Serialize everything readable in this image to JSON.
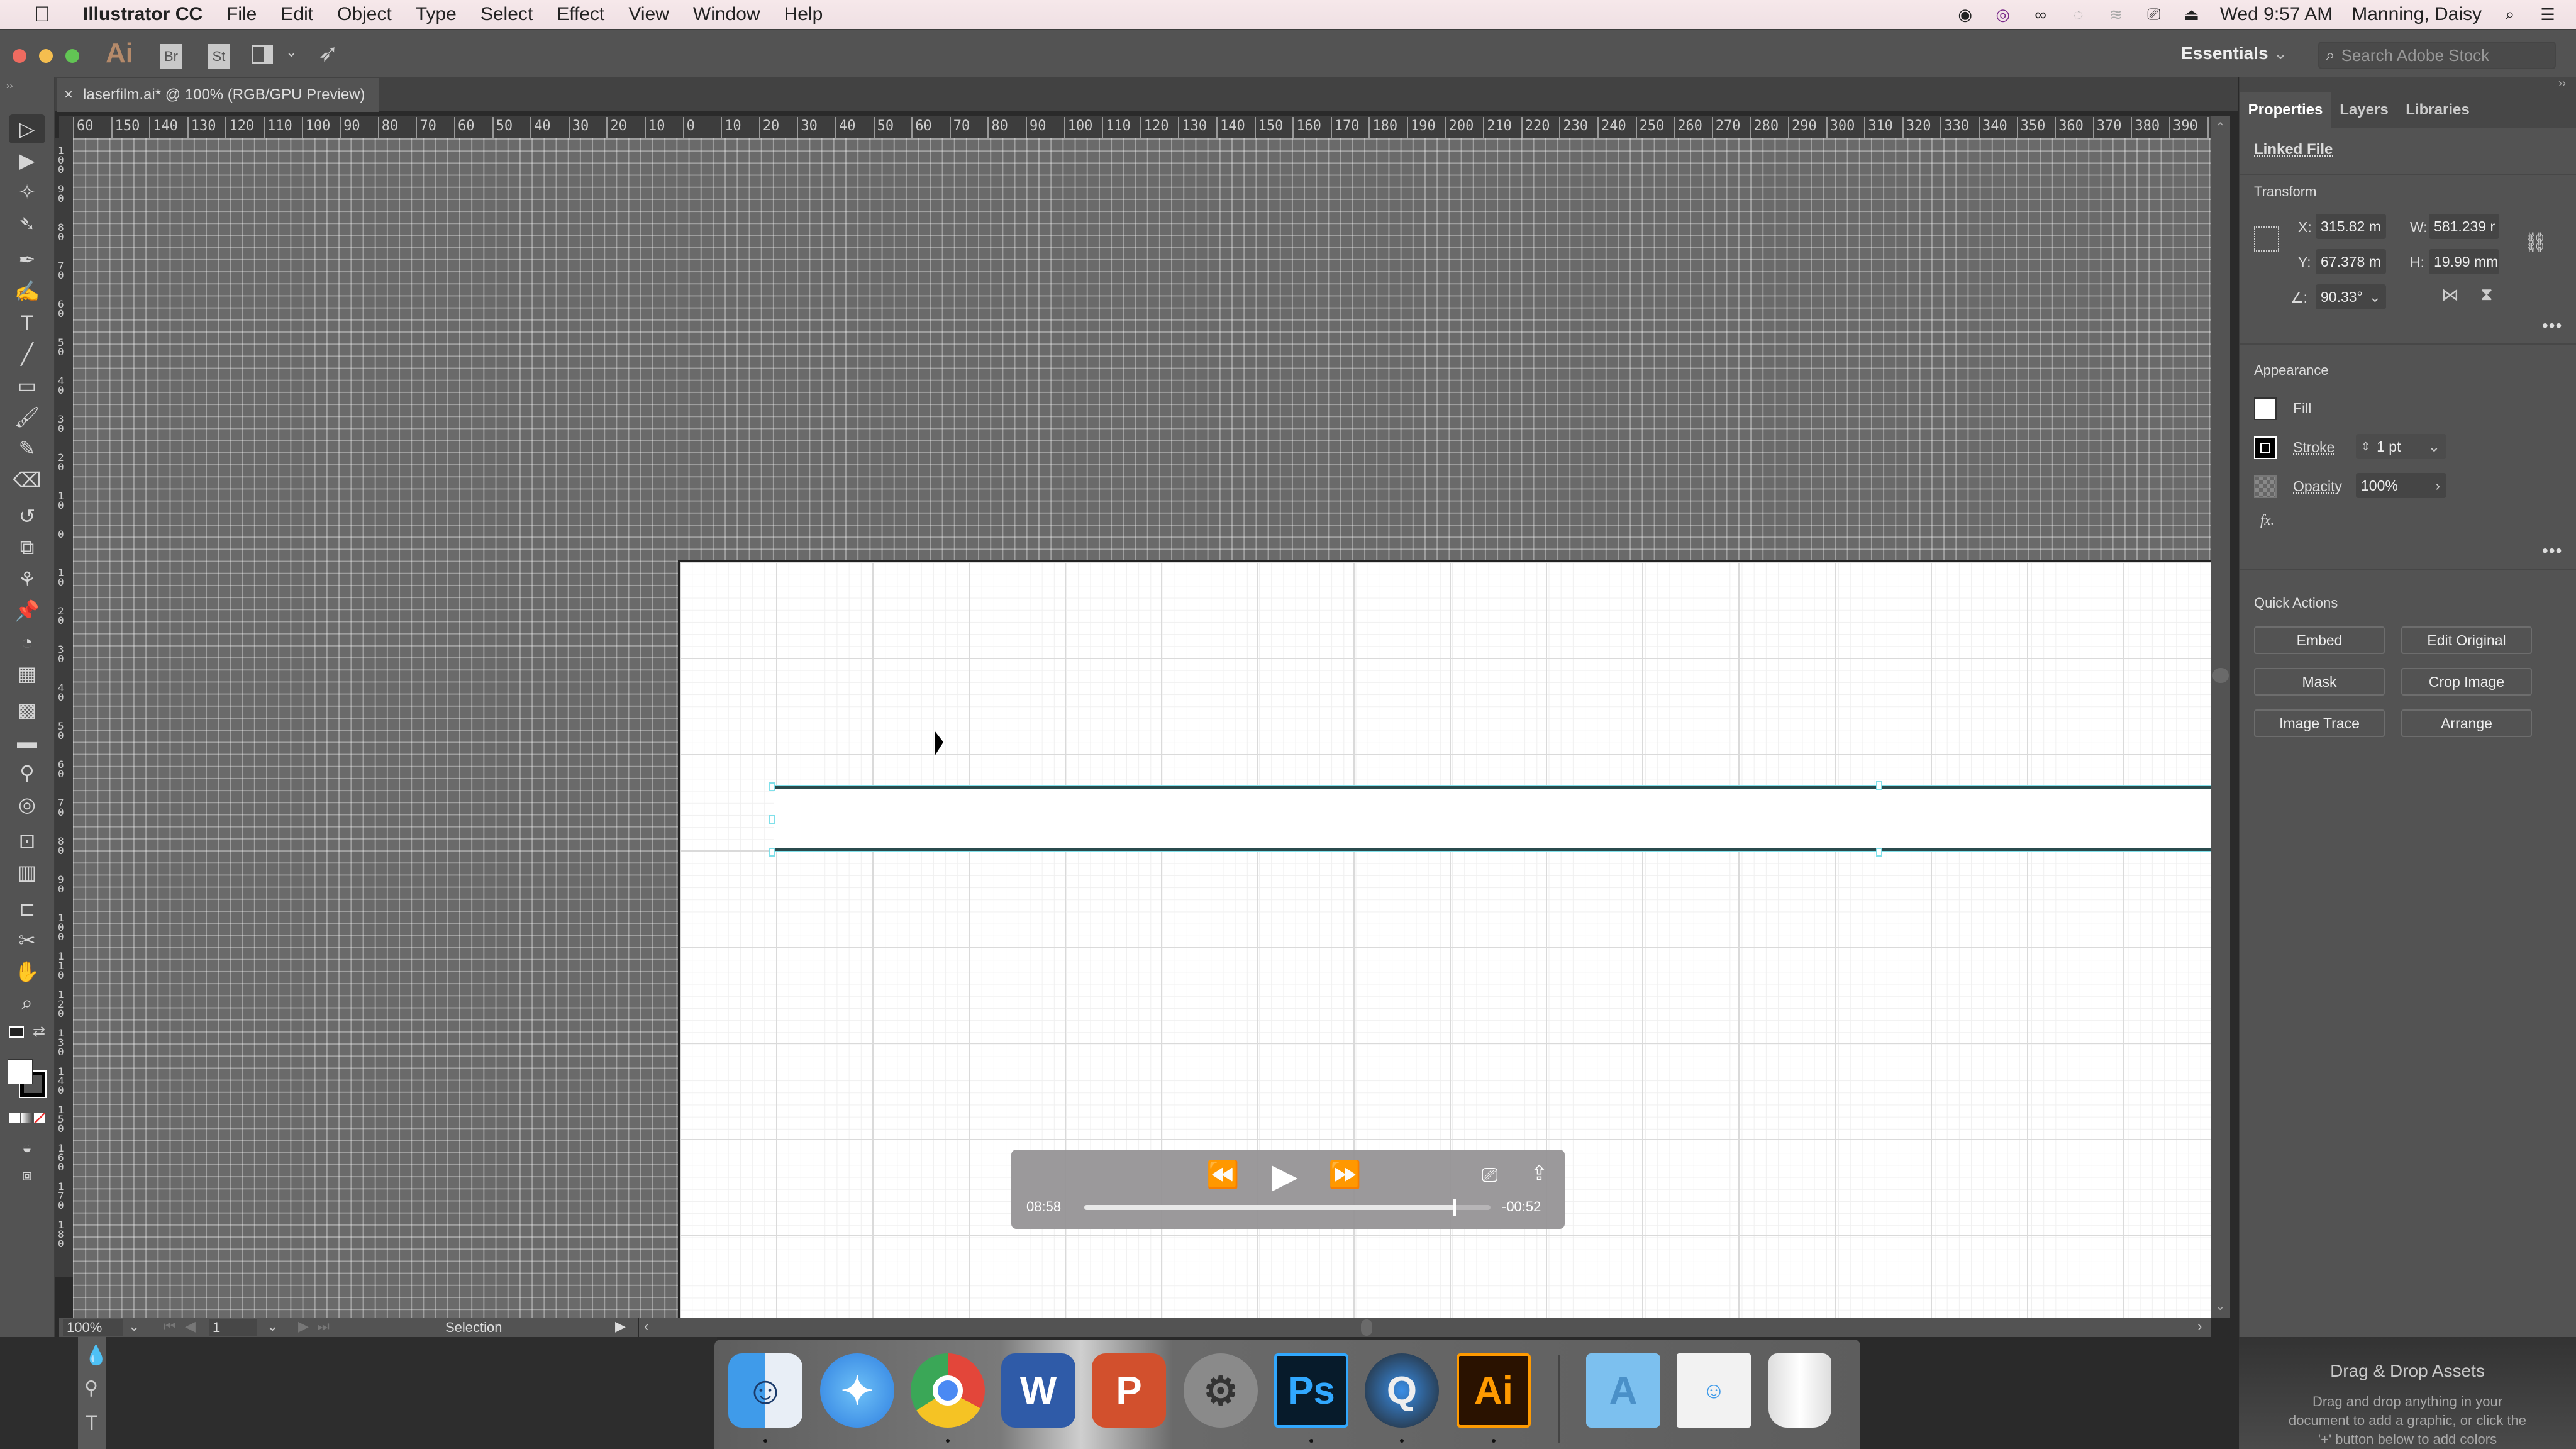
{
  "menubar": {
    "app_name": "Illustrator CC",
    "menus": [
      "File",
      "Edit",
      "Object",
      "Type",
      "Select",
      "Effect",
      "View",
      "Window",
      "Help"
    ],
    "clock": "Wed 9:57 AM",
    "user": "Manning, Daisy"
  },
  "appbar": {
    "logo": "Ai",
    "bridge": "Br",
    "stock": "St",
    "workspace": "Essentials",
    "search_placeholder": "Search Adobe Stock"
  },
  "document": {
    "tab_title": "laserfilm.ai* @ 100% (RGB/GPU Preview)"
  },
  "rulers": {
    "horizontal": [
      "60",
      "150",
      "140",
      "130",
      "120",
      "110",
      "100",
      "90",
      "80",
      "70",
      "60",
      "50",
      "40",
      "30",
      "20",
      "10",
      "0",
      "10",
      "20",
      "30",
      "40",
      "50",
      "60",
      "70",
      "80",
      "90",
      "100",
      "110",
      "120",
      "130",
      "140",
      "150",
      "160",
      "170",
      "180",
      "190",
      "200",
      "210",
      "220",
      "230",
      "240",
      "250",
      "260",
      "270",
      "280",
      "290",
      "300",
      "310",
      "320",
      "330",
      "340",
      "350",
      "360",
      "370",
      "380",
      "390",
      "40"
    ],
    "vertical": [
      "100",
      "90",
      "80",
      "70",
      "60",
      "50",
      "40",
      "30",
      "20",
      "10",
      "0",
      "10",
      "20",
      "30",
      "40",
      "50",
      "60",
      "70",
      "80",
      "90",
      "100",
      "110",
      "120",
      "130",
      "140",
      "150",
      "160",
      "170",
      "180"
    ]
  },
  "statusbar": {
    "zoom": "100%",
    "artboard": "1",
    "tool": "Selection"
  },
  "player": {
    "elapsed": "08:58",
    "remaining": "-00:52",
    "progress": 0.912
  },
  "panel": {
    "tabs": [
      "Properties",
      "Layers",
      "Libraries"
    ],
    "active_tab": "Properties",
    "object_type": "Linked File",
    "transform": {
      "title": "Transform",
      "x_label": "X:",
      "x": "315.82 m",
      "y_label": "Y:",
      "y": "67.378 m",
      "w_label": "W:",
      "w": "581.239 r",
      "h_label": "H:",
      "h": "19.99 mm",
      "angle_label": ":",
      "angle": "90.33°"
    },
    "appearance": {
      "title": "Appearance",
      "fill_label": "Fill",
      "stroke_label": "Stroke",
      "stroke_value": "1 pt",
      "opacity_label": "Opacity",
      "opacity_value": "100%",
      "fx": "fx."
    },
    "quick_actions": {
      "title": "Quick Actions",
      "buttons": [
        "Embed",
        "Edit Original",
        "Mask",
        "Crop Image",
        "Image Trace",
        "Arrange"
      ]
    }
  },
  "libraries_hint": {
    "title": "Drag & Drop Assets",
    "body": "Drag and drop anything in your document to add a graphic, or click the '+' button below to add colors"
  },
  "dock": {
    "apps": [
      "Finder",
      "Safari",
      "Chrome",
      "Word",
      "PowerPoint",
      "System Preferences",
      "Photoshop",
      "QuickTime Player",
      "Illustrator",
      "Applications",
      "Downloads",
      "Trash"
    ]
  }
}
